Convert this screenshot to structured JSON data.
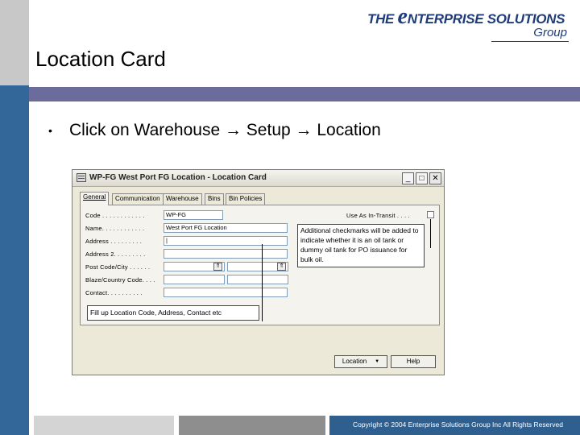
{
  "slide": {
    "title": "Location Card",
    "bullet": "Click on Warehouse → Setup → Location",
    "copyright": "Copyright © 2004 Enterprise Solutions Group Inc All Rights Reserved"
  },
  "logo": {
    "the": "THE",
    "e": "e",
    "rest": "NTERPRISE SOLUTIONS",
    "group": "Group"
  },
  "window": {
    "title": "WP-FG West Port FG Location - Location Card",
    "min_label": "_",
    "max_label": "□",
    "close_label": "✕",
    "tabs": [
      {
        "label": "General"
      },
      {
        "label": "Communication"
      },
      {
        "label": "Warehouse"
      },
      {
        "label": "Bins"
      },
      {
        "label": "Bin Policies"
      }
    ],
    "fields": {
      "code": {
        "label": "Code . . . . . . . . . . . .",
        "value": "WP-FG"
      },
      "name": {
        "label": "Name. . . . . . . . . . . .",
        "value": "West Port FG Location"
      },
      "address": {
        "label": "Address . . . . . . . . .",
        "value": "|"
      },
      "address2": {
        "label": "Address 2. . . . . . . . .",
        "value": ""
      },
      "postcode": {
        "label": "Post Code/City . . . . . .",
        "value": ""
      },
      "country": {
        "label": "Blaze/Country Code. . . .",
        "value": ""
      },
      "contact": {
        "label": "Contact. . . . . . . . . .",
        "value": ""
      },
      "use_as_in_transit": {
        "label": "Use As In-Transit . . . ."
      }
    },
    "callout_right": "Additional checkmarks will be added to indicate whether it is an oil tank or dummy oil tank for PO issuance for bulk oil.",
    "callout_left": "Fill up Location Code, Address, Contact etc",
    "buttons": {
      "location": "Location",
      "help": "Help"
    }
  }
}
